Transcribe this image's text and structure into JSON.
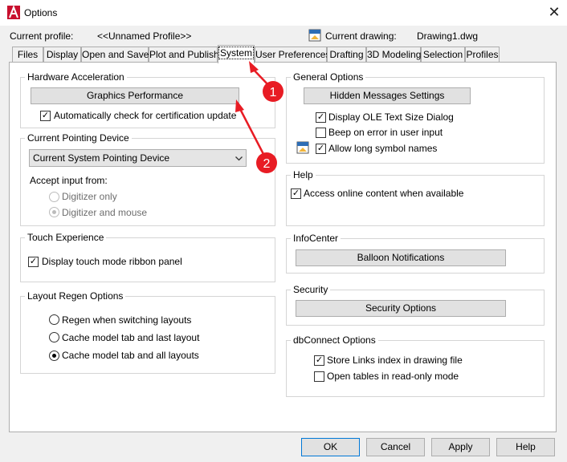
{
  "window": {
    "title": "Options",
    "close_glyph": "✕"
  },
  "profile": {
    "current_profile_label": "Current profile:",
    "current_profile_value": "<<Unnamed Profile>>",
    "current_drawing_label": "Current drawing:",
    "current_drawing_value": "Drawing1.dwg"
  },
  "tabs": [
    {
      "label": "Files"
    },
    {
      "label": "Display"
    },
    {
      "label": "Open and Save"
    },
    {
      "label": "Plot and Publish"
    },
    {
      "label": "System",
      "active": true
    },
    {
      "label": "User Preferences"
    },
    {
      "label": "Drafting"
    },
    {
      "label": "3D Modeling"
    },
    {
      "label": "Selection"
    },
    {
      "label": "Profiles"
    }
  ],
  "hardware": {
    "title": "Hardware Acceleration",
    "graphics_button": "Graphics Performance",
    "auto_check_label": "Automatically check for certification update",
    "auto_check_checked": true
  },
  "pointing": {
    "title": "Current Pointing Device",
    "selected": "Current System Pointing Device",
    "accept_label": "Accept input from:",
    "options": [
      {
        "label": "Digitizer only",
        "selected": false
      },
      {
        "label": "Digitizer and mouse",
        "selected": true
      }
    ]
  },
  "touch": {
    "title": "Touch Experience",
    "ribbon_label": "Display touch mode ribbon panel",
    "ribbon_checked": true
  },
  "layout_regen": {
    "title": "Layout Regen Options",
    "options": [
      {
        "label": "Regen when switching layouts",
        "selected": false
      },
      {
        "label": "Cache model tab and last layout",
        "selected": false
      },
      {
        "label": "Cache model tab and all layouts",
        "selected": true
      }
    ]
  },
  "general": {
    "title": "General Options",
    "hidden_messages_button": "Hidden Messages Settings",
    "items": [
      {
        "label": "Display OLE Text Size Dialog",
        "checked": true
      },
      {
        "label": "Beep on error in user input",
        "checked": false
      },
      {
        "label": "Allow long symbol names",
        "checked": true
      }
    ]
  },
  "help": {
    "title": "Help",
    "online_label": "Access online content when available",
    "online_checked": true
  },
  "infocenter": {
    "title": "InfoCenter",
    "balloon_button": "Balloon Notifications"
  },
  "security": {
    "title": "Security",
    "security_button": "Security Options"
  },
  "dbconnect": {
    "title": "dbConnect Options",
    "items": [
      {
        "label": "Store Links index in drawing file",
        "checked": true
      },
      {
        "label": "Open tables in read-only mode",
        "checked": false
      }
    ]
  },
  "footer": {
    "ok": "OK",
    "cancel": "Cancel",
    "apply": "Apply",
    "help": "Help"
  },
  "annotations": {
    "marker1": "1",
    "marker2": "2",
    "color": "#e81c24"
  },
  "check_glyph": "✓"
}
